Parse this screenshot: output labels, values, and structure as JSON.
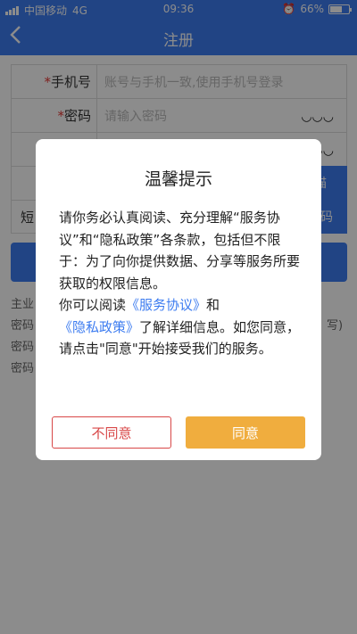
{
  "status_bar": {
    "carrier": "中国移动",
    "network": "4G",
    "time": "09:36",
    "battery_text": "66%",
    "battery_level": 0.66
  },
  "nav": {
    "back_icon": "‹",
    "title": "注册"
  },
  "form": {
    "phone_label": "手机号",
    "phone_placeholder": "账号与手机一致,使用手机号登录",
    "password_label": "密码",
    "password_placeholder": "请输入密码",
    "eye_icon": "◡◡◡",
    "required_mark": "*",
    "scan_button": "描",
    "sms_label_partial": "短",
    "sms_button": "证码"
  },
  "notes": {
    "line1": "主业",
    "line2": "密码",
    "line3": "密码",
    "line4": "密码",
    "line2_tail": "写)"
  },
  "dialog": {
    "title": "温馨提示",
    "body_part1": "请你务必认真阅读、充分理解“服务协议”和“隐私政策”各条款，包括但不限于：为了向你提供数据、分享等服务所要获取的权限信息。",
    "body_part2_prefix": "你可以阅读",
    "link_service": "《服务协议》",
    "body_and": "和",
    "link_privacy": "《隐私政策》",
    "body_part2_suffix": "了解详细信息。如您同意，请点击\"同意\"开始接受我们的服务。",
    "disagree_label": "不同意",
    "agree_label": "同意"
  },
  "colors": {
    "primary": "#3d7cf0",
    "agree": "#f0ad3e",
    "disagree": "#d84747",
    "required": "#e53935"
  }
}
